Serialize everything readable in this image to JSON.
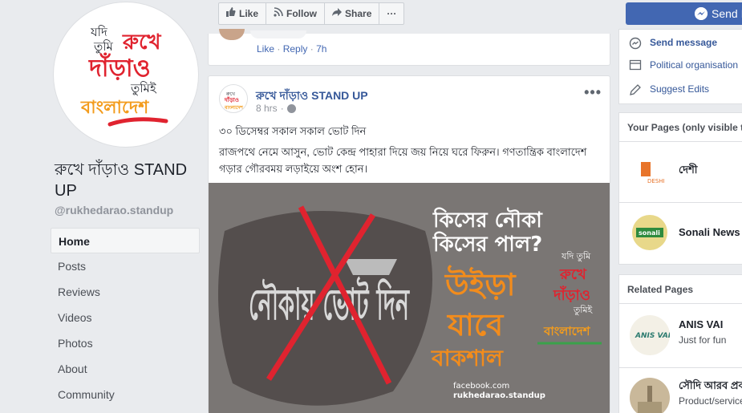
{
  "page": {
    "name": "রুখে দাঁড়াও STAND UP",
    "handle": "@rukhedarao.standup",
    "logo": {
      "line1": "যদি",
      "line2": "তুমি",
      "line3": "রুখে",
      "line4": "দাঁড়াও",
      "line5": "তুমিই",
      "line6": "বাংলাদেশ"
    }
  },
  "nav": {
    "items": [
      {
        "label": "Home",
        "active": true
      },
      {
        "label": "Posts"
      },
      {
        "label": "Reviews"
      },
      {
        "label": "Videos"
      },
      {
        "label": "Photos"
      },
      {
        "label": "About"
      },
      {
        "label": "Community"
      }
    ]
  },
  "toolbar": {
    "like": "Like",
    "follow": "Follow",
    "share": "Share",
    "more": "···"
  },
  "comment": {
    "like": "Like",
    "separator": "·",
    "reply": "Reply",
    "time": "7h"
  },
  "post": {
    "author": "রুখে দাঁড়াও STAND UP",
    "time": "8 hrs",
    "more": "•••",
    "line1": "৩০ ডিসেম্বর সকাল সকাল ভোট দিন",
    "line2": "রাজপথে নেমে আসুন, ভোট কেন্দ্র পাহারা দিয়ে জয় নিয়ে ঘরে ফিরুন। গণতান্ত্রিক বাংলাদেশ গড়ার গৌরবময় লড়াইয়ে অংশ হোন।",
    "image": {
      "big_left": "নৌকায় ভোট দিন",
      "top_right_1": "কিসের নৌকা",
      "top_right_2": "কিসের পাল?",
      "orange_1": "উইড়া",
      "orange_2": "যাবে",
      "orange_3": "বাকশাল",
      "footer_1": "facebook.com",
      "footer_2": "rukhedarao.standup",
      "stamp_1": "যদি তুমি",
      "stamp_2": "রুখে",
      "stamp_3": "দাঁড়াও",
      "stamp_4": "তুমিই",
      "stamp_5": "বাংলাদেশ"
    }
  },
  "right": {
    "send_button": "Send I",
    "send_message": "Send message",
    "political": "Political organisation",
    "suggest": "Suggest Edits",
    "your_pages_title": "Your Pages (only visible t",
    "your_pages": [
      {
        "name": "দেশী",
        "thumb": "DESHI"
      },
      {
        "name": "Sonali News",
        "thumb": "sonali"
      }
    ],
    "related_title": "Related Pages",
    "related": [
      {
        "name": "ANIS VAI",
        "sub": "Just for fun",
        "thumb": "ANIS VAI"
      },
      {
        "name": "সৌদি আরব প্রবা",
        "sub": "Product/service"
      }
    ]
  },
  "colors": {
    "fb_blue": "#4267b2",
    "link": "#365899",
    "logo_red": "#e0232f",
    "logo_orange": "#f39c1d",
    "poster_orange": "#f28c1c"
  }
}
